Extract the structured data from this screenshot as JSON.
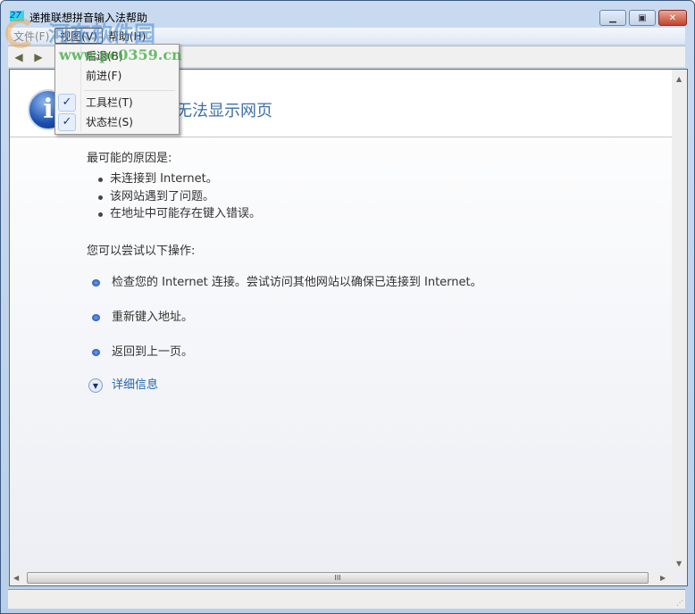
{
  "window": {
    "title": "递推联想拼音输入法帮助",
    "app_icon": "27",
    "minimize": "minimize",
    "maximize": "maximize",
    "close": "close"
  },
  "menu": [
    {
      "label": "文件(F)"
    },
    {
      "label": "视图(V)"
    },
    {
      "label": "帮助(H)"
    }
  ],
  "toolbar": {
    "back_icon": "back-arrow-icon",
    "forward_icon": "forward-arrow-icon"
  },
  "view_menu": {
    "items": [
      {
        "label": "后退(B)"
      },
      {
        "label": "前进(F)"
      },
      {
        "label": "工具栏(T)",
        "checked": true
      },
      {
        "label": "状态栏(S)",
        "checked": true
      }
    ],
    "check": "✓"
  },
  "page": {
    "title": "无法显示网页",
    "reasons_heading": "最可能的原因是:",
    "reasons": [
      "未连接到 Internet。",
      "该网站遇到了问题。",
      "在地址中可能存在键入错误。"
    ],
    "try_heading": "您可以尝试以下操作:",
    "actions": [
      "检查您的 Internet 连接。尝试访问其他网站以确保已连接到 Internet。",
      "重新键入地址。",
      "返回到上一页。"
    ],
    "more_info": "详细信息"
  },
  "scrollbar": {
    "grip": "III"
  },
  "watermark": {
    "name": "河东软件园",
    "url": "www.pc0359.cn"
  }
}
